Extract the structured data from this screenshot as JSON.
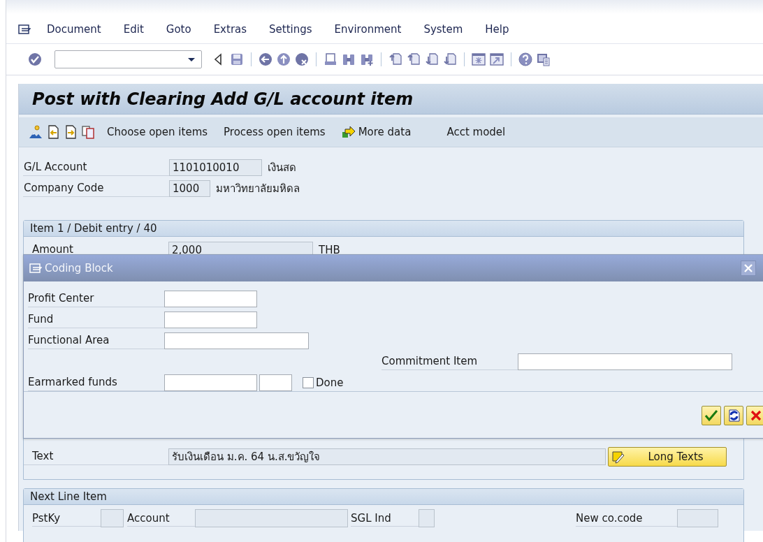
{
  "menu": [
    {
      "label": "Document"
    },
    {
      "label": "Edit"
    },
    {
      "label": "Goto"
    },
    {
      "label": "Extras"
    },
    {
      "label": "Settings"
    },
    {
      "label": "Environment"
    },
    {
      "label": "System"
    },
    {
      "label": "Help"
    }
  ],
  "screen_title": "Post with Clearing Add G/L account item",
  "app_toolbar": [
    {
      "label": "Choose open items",
      "has_icon": false
    },
    {
      "label": "Process open items",
      "has_icon": false
    },
    {
      "label": "More data",
      "has_icon": true
    },
    {
      "label": "Acct model",
      "has_icon": false
    }
  ],
  "header_fields": [
    {
      "label": "G/L Account",
      "value": "1101010010",
      "description": "เงินสด",
      "kind": "long"
    },
    {
      "label": "Company Code",
      "value": "1000",
      "description": "มหาวิทยาลัยมหิดล",
      "kind": "short"
    }
  ],
  "item": {
    "title": "Item 1 / Debit entry / 40",
    "amount": {
      "label": "Amount",
      "value": "2,000",
      "currency": "THB"
    },
    "text": {
      "label": "Text",
      "value": "รับเงินเดือน ม.ค. 64 น.ส.ขวัญใจ"
    },
    "long_texts_button": "Long Texts"
  },
  "dialog": {
    "title": "Coding Block",
    "fields": [
      {
        "label": "Profit Center",
        "kind": "medium"
      },
      {
        "label": "Fund",
        "kind": "medium"
      },
      {
        "label": "Functional Area",
        "kind": "wide"
      },
      {
        "label": "Commitment Item",
        "kind": "right"
      },
      {
        "label": "Earmarked funds",
        "kind": "earmarked",
        "checkbox": {
          "label": "Done",
          "checked": false
        }
      }
    ]
  },
  "next_line_item": {
    "title": "Next Line Item",
    "fields": [
      {
        "label": "PstKy",
        "kind": "tiny"
      },
      {
        "label": "Account",
        "kind": "account"
      },
      {
        "label": "SGL Ind",
        "kind": "mini"
      },
      {
        "label": "New co.code",
        "kind": "cocode"
      }
    ]
  }
}
